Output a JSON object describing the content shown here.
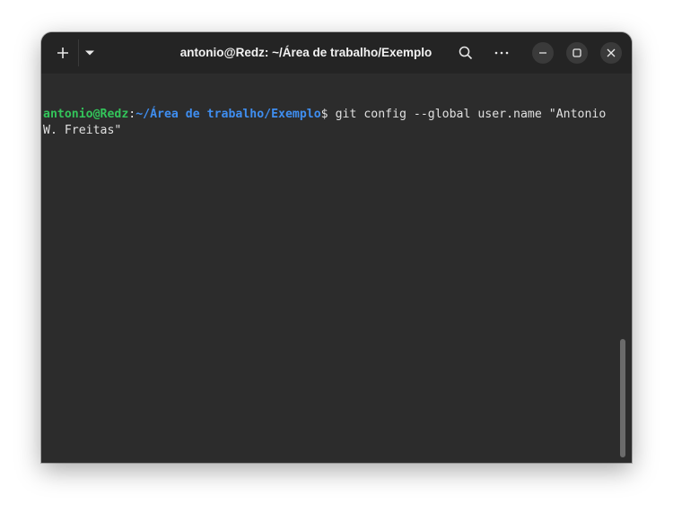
{
  "window": {
    "title": "antonio@Redz: ~/Área de trabalho/Exemplo"
  },
  "toolbar": {
    "new_tab_icon": "plus-icon",
    "tab_menu_icon": "chevron-down-icon",
    "search_icon": "search-icon",
    "menu_icon": "more-horizontal-icon",
    "minimize_icon": "minimize-icon",
    "maximize_icon": "maximize-icon",
    "close_icon": "close-icon"
  },
  "terminal": {
    "prompt_user_host": "antonio@Redz",
    "prompt_colon": ":",
    "prompt_path": "~/Área de trabalho/Exemplo",
    "prompt_symbol": "$ ",
    "command": "git config --global user.name \"Antonio W. Freitas\""
  },
  "colors": {
    "background": "#2c2c2c",
    "titlebar": "#242424",
    "prompt_user": "#33c45a",
    "prompt_path": "#3f8ef0",
    "text": "#e0e0e0"
  }
}
